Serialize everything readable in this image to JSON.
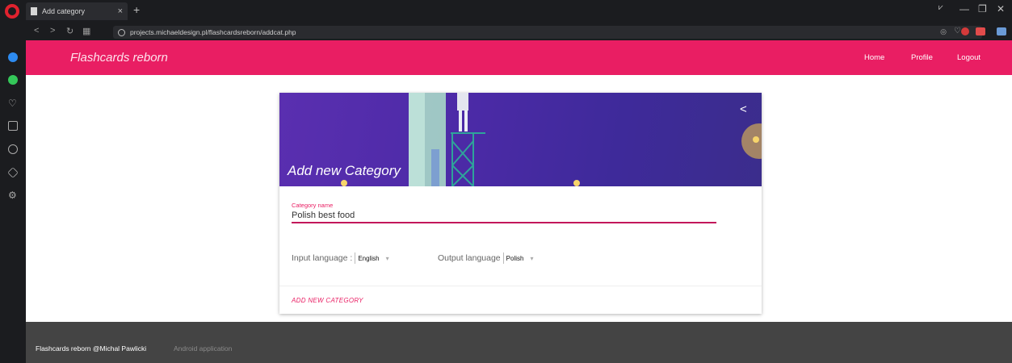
{
  "browser": {
    "tab_title": "Add category",
    "tab_close": "×",
    "new_tab": "+",
    "url": "projects.michaeldesign.pl/flashcardsreborn/addcat.php",
    "minimize": "—",
    "maximize": "❐",
    "close": "✕"
  },
  "appbar": {
    "brand": "Flashcards reborn",
    "nav": [
      "Home",
      "Profile",
      "Logout"
    ]
  },
  "card": {
    "title": "Add new Category",
    "field_label": "Category name",
    "field_value": "Polish best food",
    "input_language_label": "Input language :",
    "input_language_value": "English",
    "output_language_label": "Output language",
    "output_language_value": "Polish",
    "action": "ADD NEW CATEGORY"
  },
  "footer": {
    "text": "Flashcards reborn @Michal Pawlicki",
    "sub": "Android application"
  },
  "colors": {
    "accent": "#e91e63",
    "hero": "#4b2aa6",
    "footer": "#444444"
  }
}
